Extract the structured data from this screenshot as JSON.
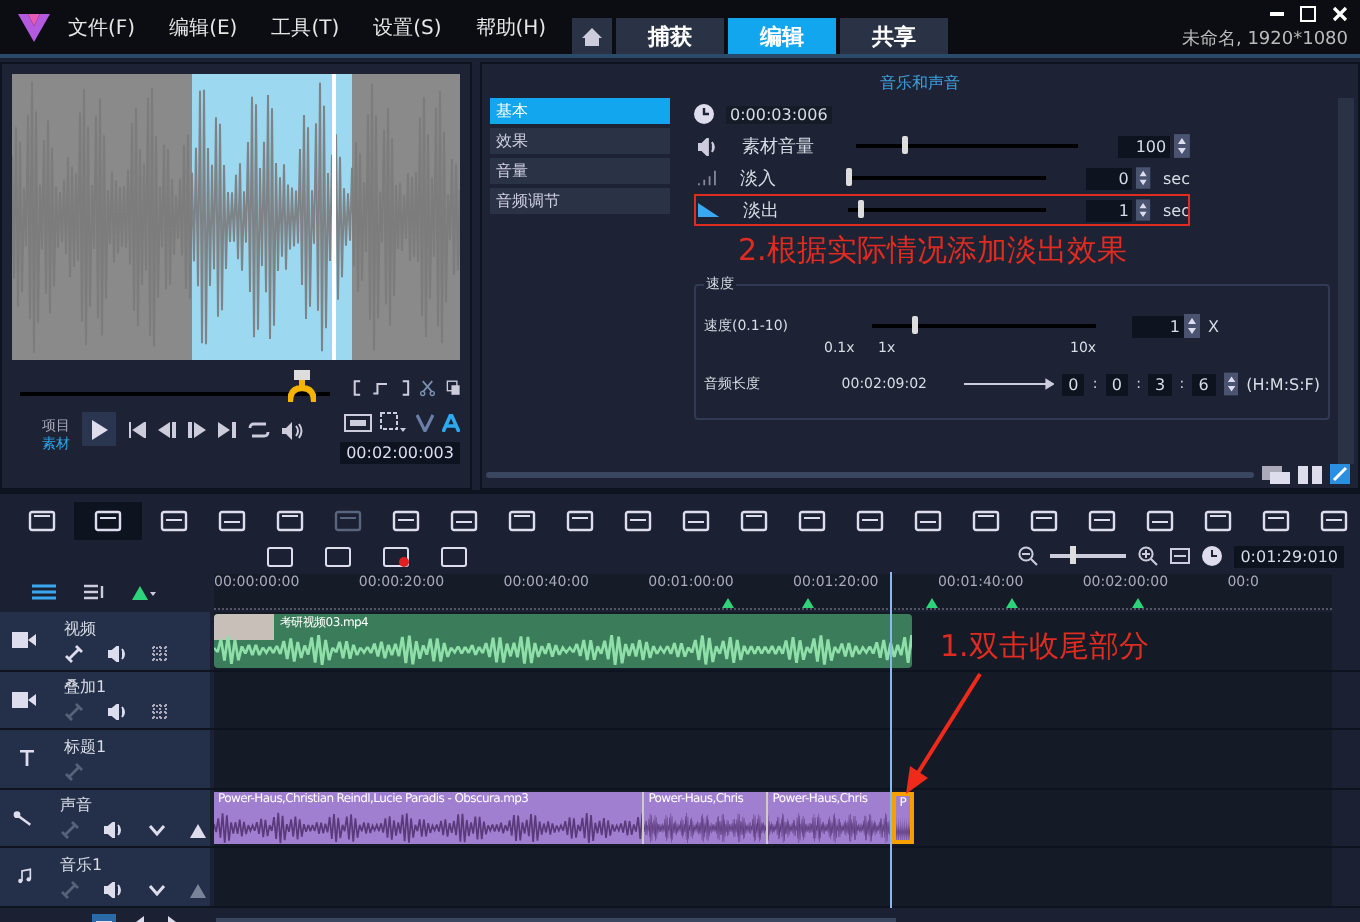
{
  "menu": [
    "文件(F)",
    "编辑(E)",
    "工具(T)",
    "设置(S)",
    "帮助(H)"
  ],
  "tabs": [
    {
      "label": "捕获",
      "selected": false
    },
    {
      "label": "编辑",
      "selected": true
    },
    {
      "label": "共享",
      "selected": false
    }
  ],
  "project_info": "未命名, 1920*1080",
  "preview": {
    "scrub": {
      "level": 0.91
    },
    "modes": [
      {
        "label": "项目",
        "selected": false
      },
      {
        "label": "素材",
        "selected": true
      }
    ],
    "timecode": "00:02:00:003"
  },
  "options": {
    "title": "音乐和声音",
    "side_tabs": [
      {
        "label": "基本",
        "selected": true
      },
      {
        "label": "效果",
        "selected": false
      },
      {
        "label": "音量",
        "selected": false
      },
      {
        "label": "音频调节",
        "selected": false
      }
    ],
    "duration": "0:00:03:006",
    "rows": [
      {
        "kind": "volume",
        "label": "素材音量",
        "level": 0.2,
        "value": "100",
        "highlighted": false
      },
      {
        "kind": "fadein",
        "label": "淡入",
        "level": 0,
        "value": "0",
        "unit": "sec",
        "highlighted": false
      },
      {
        "kind": "fadeout",
        "label": "淡出",
        "level": 0.05,
        "value": "1",
        "unit": "sec",
        "highlighted": true
      }
    ],
    "speed": {
      "title": "速度",
      "label": "速度(0.1-10)",
      "level": 0.18,
      "value": "1",
      "unit": "X",
      "ticks": [
        "0.1x",
        "1x",
        "10x"
      ]
    },
    "length": {
      "label": "音频长度",
      "original": "00:02:09:02",
      "fields": [
        "0",
        "0",
        "3",
        "6"
      ],
      "separator": ":",
      "unit": "(H:M:S:F)"
    }
  },
  "annotation_2": "2.根据实际情况添加淡出效果",
  "timeline": {
    "zoom": {
      "level": 0.3
    },
    "timecode": "0:01:29:010",
    "ruler": [
      "00:00:00:00",
      "00:00:20:00",
      "00:00:40:00",
      "00:01:00:00",
      "00:01:20:00",
      "00:01:40:00",
      "00:02:00:00",
      "00:0"
    ],
    "tracks": [
      {
        "kind": "video",
        "name": "视频",
        "clips": [
          {
            "label": "考研视频03.mp4",
            "selected": false
          }
        ]
      },
      {
        "kind": "overlay",
        "name": "叠加1"
      },
      {
        "kind": "title",
        "name": "标题1"
      },
      {
        "kind": "voice",
        "name": "声音",
        "clips": [
          {
            "label": "Power-Haus,Christian Reindl,Lucie Paradis - Obscura.mp3",
            "selected": false
          },
          {
            "label": "Power-Haus,Chris",
            "selected": false
          },
          {
            "label": "Power-Haus,Chris",
            "selected": false
          },
          {
            "label": "P",
            "selected": true
          }
        ]
      },
      {
        "kind": "music",
        "name": "音乐1"
      }
    ]
  },
  "annotation_1": "1.双击收尾部分"
}
